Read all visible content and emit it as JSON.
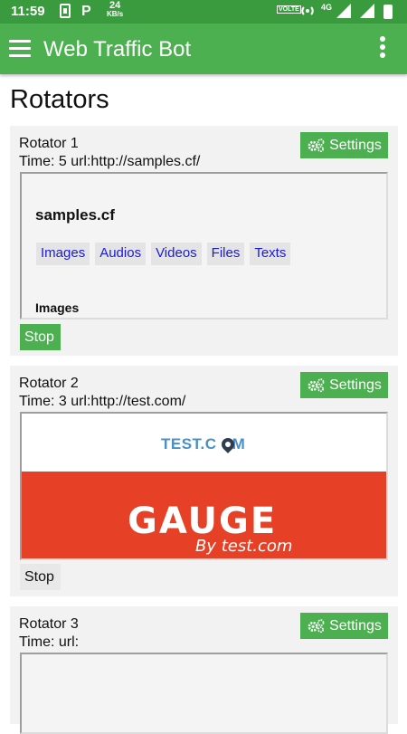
{
  "status_bar": {
    "time": "11:59",
    "net_speed_value": "24",
    "net_speed_unit": "KB/s",
    "network": "4G",
    "volte": "VOLTE"
  },
  "app_bar": {
    "title": "Web Traffic Bot",
    "menu_icon": "hamburger-menu-icon",
    "overflow_icon": "more-vert-icon",
    "color": "#4caf50"
  },
  "page": {
    "title": "Rotators"
  },
  "rotators": [
    {
      "name": "Rotator 1",
      "info": "Time: 5 url:http://samples.cf/",
      "settings_label": "Settings",
      "stop_label": "Stop",
      "preview": {
        "heading": "samples.cf",
        "tabs": [
          "Images",
          "Audios",
          "Videos",
          "Files",
          "Texts"
        ],
        "section": "Images"
      }
    },
    {
      "name": "Rotator 2",
      "info": "Time: 3 url:http://test.com/",
      "settings_label": "Settings",
      "stop_label": "Stop",
      "preview": {
        "logo_text": "TEST.C",
        "logo_text_end": "M",
        "banner_text": "GAUGE",
        "banner_sub": "By test.com",
        "banner_color": "#e64027"
      }
    },
    {
      "name": "Rotator 3",
      "info": "Time: url:",
      "settings_label": "Settings"
    }
  ],
  "colors": {
    "accent": "#4caf50",
    "status_bar": "#3a9b3e",
    "card_bg": "#f2f2f2",
    "link": "#1a1ad8"
  }
}
